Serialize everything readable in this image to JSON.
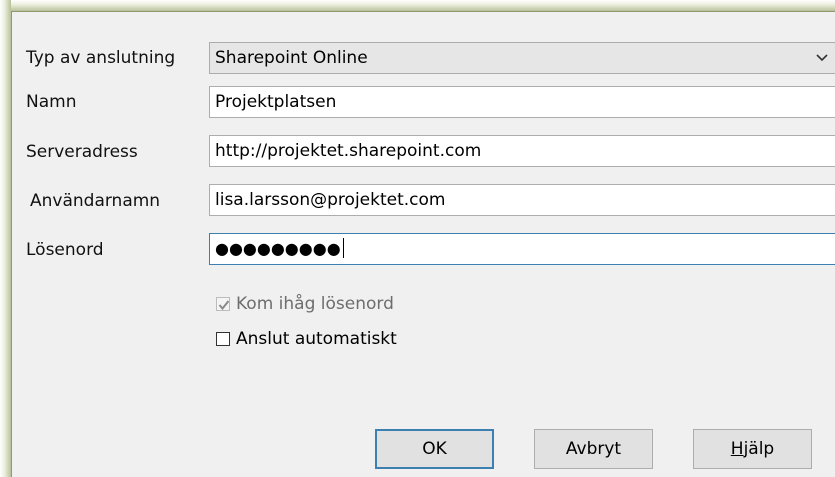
{
  "dialog": {
    "connection_type": {
      "label": "Typ av anslutning",
      "value": "Sharepoint Online"
    },
    "name": {
      "label": "Namn",
      "value": "Projektplatsen"
    },
    "server_address": {
      "label": "Serveradress",
      "value": "http://projektet.sharepoint.com"
    },
    "username": {
      "label": "Användarnamn",
      "value": "lisa.larsson@projektet.com"
    },
    "password": {
      "label": "Lösenord",
      "masked_value": "●●●●●●●●●"
    },
    "remember_password": {
      "label": "Kom ihåg lösenord",
      "checked": true,
      "enabled": false
    },
    "auto_connect": {
      "label": "Anslut automatiskt",
      "checked": false,
      "enabled": true
    },
    "buttons": {
      "ok": "OK",
      "cancel": "Avbryt",
      "help_mnemonic": "H",
      "help_rest": "jälp"
    }
  },
  "colors": {
    "dialog_bg": "#f0f0f0",
    "focus_border": "#3c7fb1",
    "frame_green": "#b8c19a"
  },
  "icons": [
    "chevron-down-icon",
    "checkmark-icon"
  ]
}
